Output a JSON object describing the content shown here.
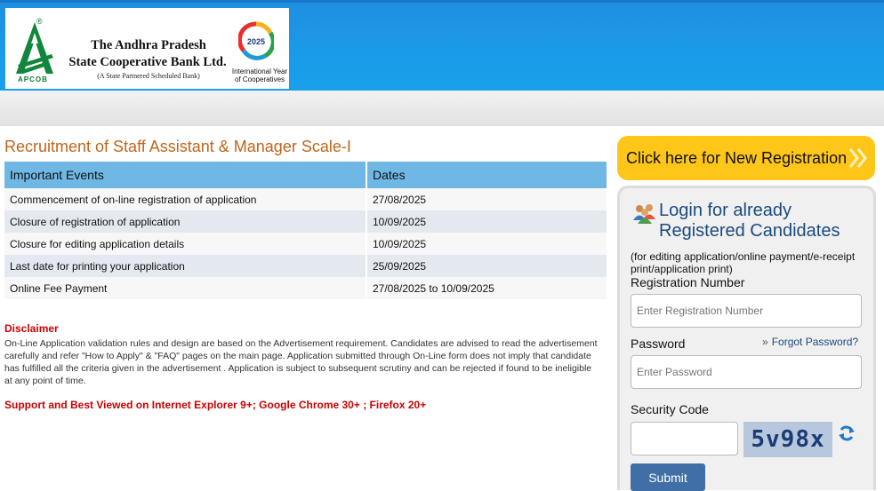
{
  "header": {
    "logo_text": "APCOB",
    "logo_reg": "®",
    "bank_name_line1": "The Andhra Pradesh",
    "bank_name_line2": "State Cooperative Bank Ltd.",
    "bank_subtitle": "(A State Partnered Scheduled Bank)",
    "iyc_year": "2025",
    "iyc_line1": "International Year",
    "iyc_line2": "of Cooperatives"
  },
  "main": {
    "title": "Recruitment of Staff Assistant & Manager Scale-I",
    "table": {
      "headers": [
        "Important Events",
        "Dates"
      ],
      "rows": [
        [
          "Commencement of on-line registration of application",
          "27/08/2025"
        ],
        [
          "Closure of registration of application",
          "10/09/2025"
        ],
        [
          "Closure for editing application details",
          "10/09/2025"
        ],
        [
          "Last date for printing your application",
          "25/09/2025"
        ],
        [
          "Online Fee Payment",
          "27/08/2025 to 10/09/2025"
        ]
      ]
    },
    "disclaimer_title": "Disclaimer",
    "disclaimer_text": "On-Line Application validation rules and design are based on the Advertisement requirement. Candidates are advised to read the advertisement carefully and refer \"How to Apply\" & \"FAQ\" pages on the main page. Application submitted through On-Line form does not imply that candidate has fulfilled all the criteria given in the advertisement . Application is subject to subsequent scrutiny and can be rejected if found to be ineligible at any point of time.",
    "support_text": "Support and Best Viewed on Internet Explorer 9+; Google Chrome 30+ ; Firefox 20+"
  },
  "sidebar": {
    "new_registration_label": "Click here for New Registration",
    "login_title_line1": "Login for already",
    "login_title_line2": "Registered Candidates",
    "login_note": "(for editing application/online payment/e-receipt print/application print)",
    "reg_number_label": "Registration Number",
    "reg_number_placeholder": "Enter Registration Number",
    "password_label": "Password",
    "password_placeholder": "Enter Password",
    "forgot_password_label": "Forgot Password?",
    "security_code_label": "Security Code",
    "captcha_text": "5v98x",
    "submit_label": "Submit"
  },
  "colors": {
    "header_blue": "#1a9be8",
    "title_orange": "#c0651a",
    "table_header": "#6fb8e6",
    "alert_red": "#cc0000",
    "registration_yellow": "#ffc61a",
    "login_blue": "#1a4a80",
    "submit_blue": "#3f6fa6"
  }
}
